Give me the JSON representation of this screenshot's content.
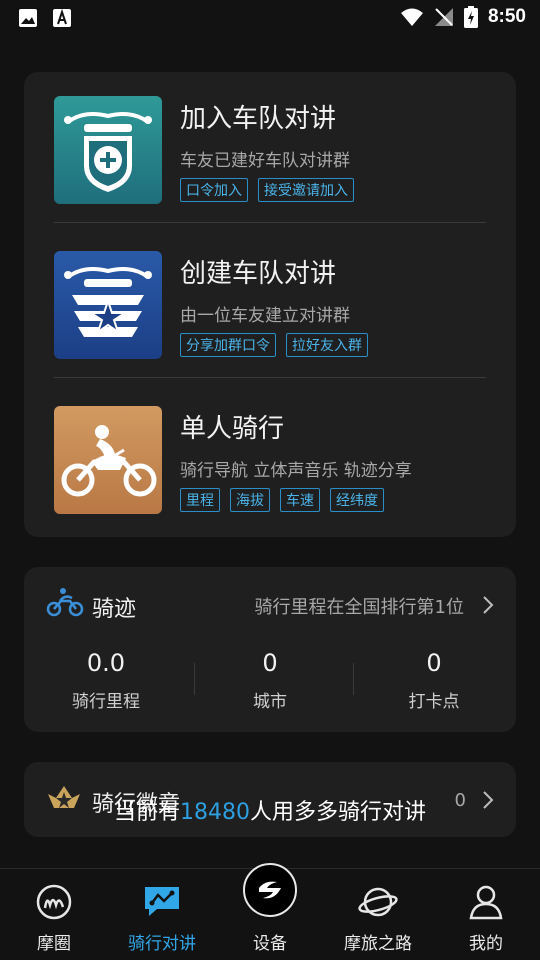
{
  "status_bar": {
    "time": "8:50"
  },
  "modes": [
    {
      "title": "加入车队对讲",
      "desc": "车友已建好车队对讲群",
      "tags": [
        "口令加入",
        "接受邀请加入"
      ],
      "icon": "shield-plus-icon",
      "color": "#2a8a8c"
    },
    {
      "title": "创建车队对讲",
      "desc": "由一位车友建立对讲群",
      "tags": [
        "分享加群口令",
        "拉好友入群"
      ],
      "icon": "shield-star-icon",
      "color": "#234e9a"
    },
    {
      "title": "单人骑行",
      "desc": "骑行导航 立体声音乐 轨迹分享",
      "tags": [
        "里程",
        "海拔",
        "车速",
        "经纬度"
      ],
      "icon": "motorcycle-rider-icon",
      "color": "#c98a52"
    }
  ],
  "track": {
    "title": "骑迹",
    "rank_text": "骑行里程在全国排行第1位",
    "stats": [
      {
        "value": "0.0",
        "label": "骑行里程"
      },
      {
        "value": "0",
        "label": "城市"
      },
      {
        "value": "0",
        "label": "打卡点"
      }
    ]
  },
  "badge": {
    "title": "骑行徽章",
    "count": "0"
  },
  "overlay": {
    "prefix": "当前有",
    "number": "18480",
    "suffix": "人用多多骑行对讲"
  },
  "tabs": [
    {
      "label": "摩圈",
      "icon": "moquan-logo-icon"
    },
    {
      "label": "骑行对讲",
      "icon": "chat-route-icon"
    },
    {
      "label": "设备",
      "icon": "device-logo-icon"
    },
    {
      "label": "摩旅之路",
      "icon": "planet-icon"
    },
    {
      "label": "我的",
      "icon": "person-icon"
    }
  ],
  "colors": {
    "accent": "#32a7e8",
    "card_bg": "#1f1f1f",
    "page_bg": "#121212"
  }
}
